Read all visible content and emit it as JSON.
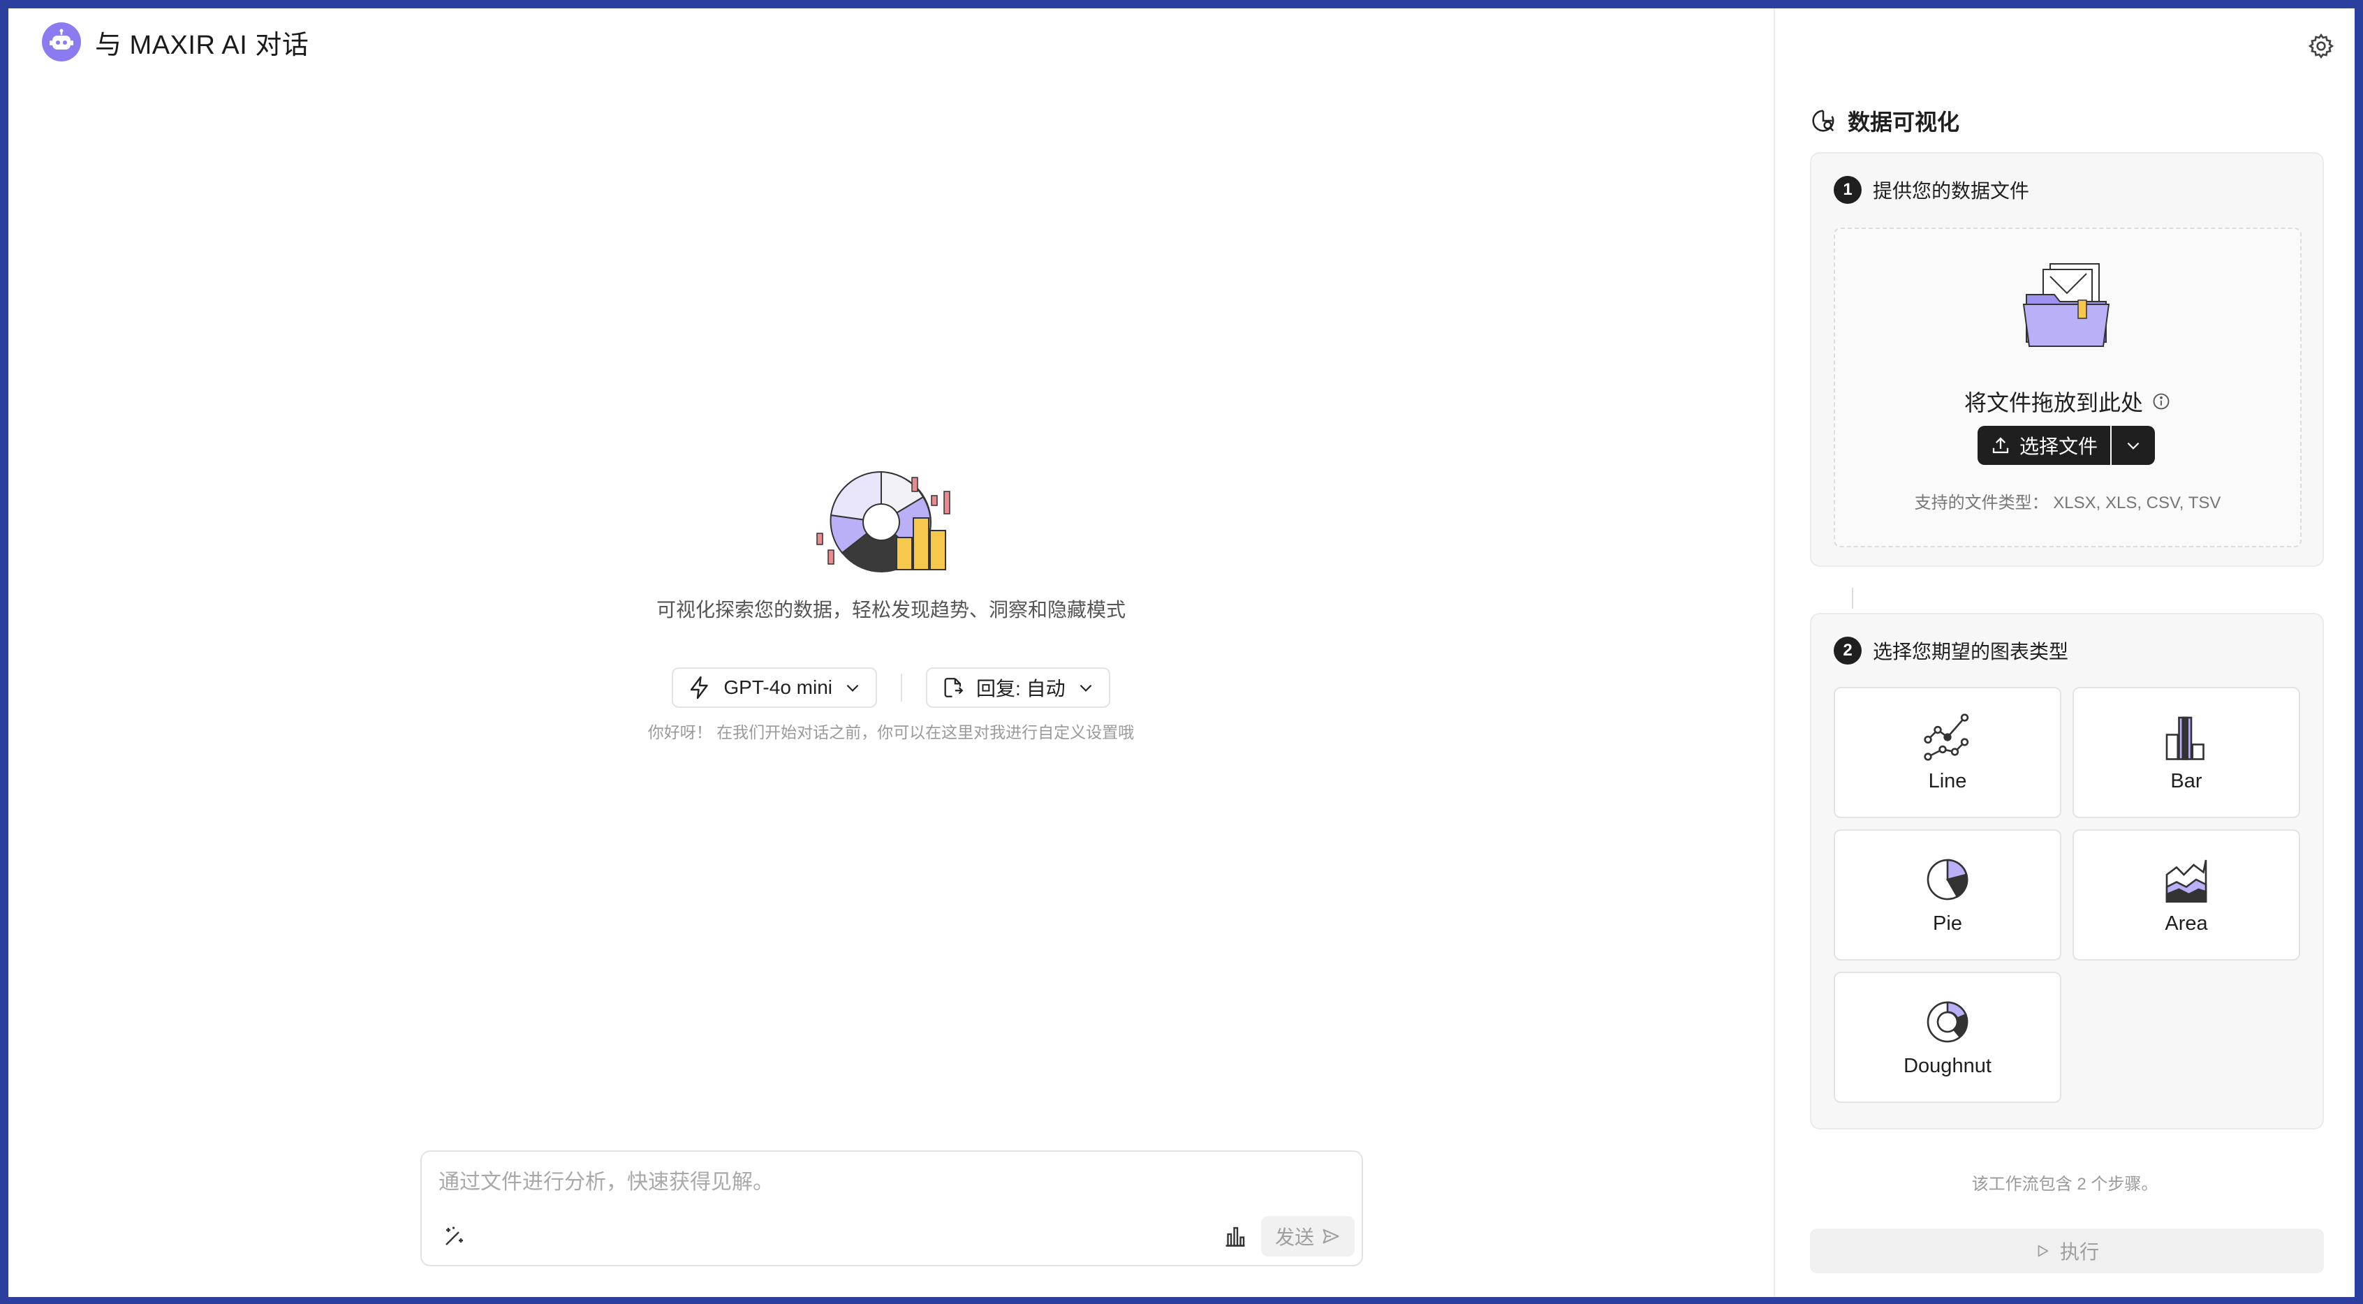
{
  "app": {
    "title": "与 MAXIR AI 对话"
  },
  "hero": {
    "description": "可视化探索您的数据，轻松发现趋势、洞察和隐藏模式",
    "hint": "你好呀！ 在我们开始对话之前，你可以在这里对我进行自定义设置哦"
  },
  "selectors": {
    "model": {
      "value": "GPT-4o mini",
      "icon": "lightning-icon"
    },
    "reply": {
      "value": "回复: 自动",
      "icon": "reply-mode-icon"
    }
  },
  "composer": {
    "placeholder": "通过文件进行分析，快速获得见解。",
    "send_label": "发送"
  },
  "panel": {
    "title": "数据可视化",
    "step1": {
      "number": "1",
      "title": "提供您的数据文件",
      "drop_label": "将文件拖放到此处",
      "upload_label": "选择文件",
      "file_types": "支持的文件类型：  XLSX, XLS, CSV, TSV"
    },
    "step2": {
      "number": "2",
      "title": "选择您期望的图表类型",
      "charts": [
        {
          "label": "Line",
          "icon": "line-chart-icon"
        },
        {
          "label": "Bar",
          "icon": "bar-chart-icon"
        },
        {
          "label": "Pie",
          "icon": "pie-chart-icon"
        },
        {
          "label": "Area",
          "icon": "area-chart-icon"
        },
        {
          "label": "Doughnut",
          "icon": "doughnut-chart-icon"
        }
      ]
    },
    "workflow_note": "该工作流包含 2 个步骤。",
    "execute_label": "执行"
  },
  "colors": {
    "accent": "#8a7cf0",
    "dark": "#1f1f1f",
    "frame": "#2a3f9e"
  }
}
